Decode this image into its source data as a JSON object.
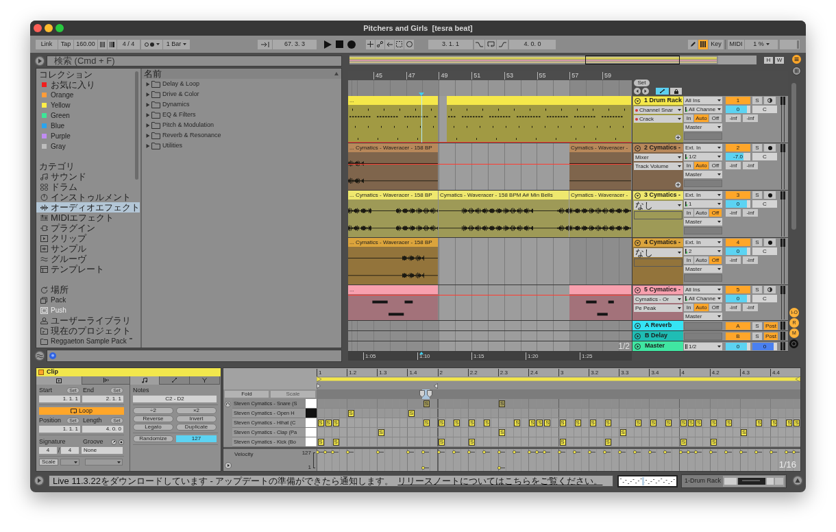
{
  "window": {
    "title": "Pitchers and Girls  [tesra beat]"
  },
  "toolbar": {
    "link": "Link",
    "tap": "Tap",
    "tempo": "160.00",
    "signature": "4 / 4",
    "quantization": "1 Bar",
    "position": "67. 3. 3",
    "loop_start": "3. 1. 1",
    "loop_length": "4. 0. 0",
    "keyboard_on": true,
    "key": "Key",
    "midi": "MIDI",
    "cpu": "1 %"
  },
  "browser": {
    "search": {
      "placeholder": "検索 (Cmd + F)"
    },
    "collections": {
      "heading": "コレクション",
      "items": [
        {
          "label": "お気に入り",
          "color": "#f01e1e"
        },
        {
          "label": "Orange",
          "color": "#ff9c3a"
        },
        {
          "label": "Yellow",
          "color": "#ffee48"
        },
        {
          "label": "Green",
          "color": "#3de698"
        },
        {
          "label": "Blue",
          "color": "#2aa4ee"
        },
        {
          "label": "Purple",
          "color": "#c08cf2"
        },
        {
          "label": "Gray",
          "color": "#bdbdbd"
        }
      ]
    },
    "categories": {
      "heading": "カテゴリ",
      "items": [
        {
          "label": "サウンド",
          "selected": false
        },
        {
          "label": "ドラム",
          "selected": false
        },
        {
          "label": "インストゥルメント",
          "selected": false
        },
        {
          "label": "オーディオエフェクト",
          "selected": true
        },
        {
          "label": "MIDIエフェクト",
          "selected": false
        },
        {
          "label": "プラグイン",
          "selected": false
        },
        {
          "label": "クリップ",
          "selected": false
        },
        {
          "label": "サンプル",
          "selected": false
        },
        {
          "label": "グルーヴ",
          "selected": false
        },
        {
          "label": "テンプレート",
          "selected": false
        }
      ]
    },
    "places": {
      "items": [
        {
          "label": "場所",
          "disabled": false,
          "update": false
        },
        {
          "label": "Pack",
          "disabled": false,
          "update": false
        },
        {
          "label": "Push",
          "disabled": true,
          "update": false
        },
        {
          "label": "ユーザーライブラリ",
          "disabled": false,
          "update": false
        },
        {
          "label": "現在のプロジェクト",
          "disabled": false,
          "update": false
        },
        {
          "label": "Reggaeton Sample Pack",
          "disabled": false,
          "update": true
        }
      ]
    },
    "list": {
      "column": "名前",
      "items": [
        {
          "label": "Delay & Loop",
          "expanded": false
        },
        {
          "label": "Drive & Color",
          "expanded": false
        },
        {
          "label": "Dynamics",
          "expanded": false
        },
        {
          "label": "EQ & Filters",
          "expanded": false
        },
        {
          "label": "Pitch & Modulation",
          "expanded": false
        },
        {
          "label": "Reverb & Resonance",
          "expanded": false
        },
        {
          "label": "Utilities",
          "expanded": false
        }
      ]
    }
  },
  "arrangement": {
    "overview_buttons": [
      "H",
      "W"
    ],
    "ruler": [
      "45",
      "47",
      "49",
      "51",
      "53",
      "55",
      "57",
      "59"
    ],
    "set": "Set",
    "automation_on": true,
    "tracks": [
      {
        "kind": "midi",
        "name": "1 Drum Rack",
        "color": "#f5e84a",
        "selected": true,
        "clips": [
          {
            "kind": "midi",
            "label": "..."
          },
          {
            "kind": "midi"
          }
        ],
        "automation": true,
        "devices": [
          {
            "label": "Channel Snar",
            "dot": true
          },
          {
            "label": "Crack",
            "dot": true
          }
        ],
        "input": "All Ins",
        "channel": "All Channe",
        "monitor": [
          {
            "label": "In",
            "selected": false
          },
          {
            "label": "Auto",
            "selected": true
          },
          {
            "label": "Off",
            "selected": false
          }
        ],
        "output": "Master",
        "number": "1",
        "solo": "S",
        "volume": {
          "value": "0",
          "level": 0.85
        },
        "pan": "C",
        "peaks": [
          "-inf",
          "-inf"
        ]
      },
      {
        "kind": "audio",
        "name": "2 Cymatics -",
        "color": "#b8885a",
        "selected": false,
        "clips": [
          {
            "kind": "audio",
            "label": "... Cymatics - Waveracer - 158 BP"
          },
          {
            "kind": "audio",
            "label": "Cymatics - Waveracer -"
          }
        ],
        "automation": true,
        "devices": [
          {
            "label": "Mixer",
            "dot": false
          },
          {
            "label": "Track Volume",
            "dot": false
          }
        ],
        "input": "Ext. In",
        "channel": "1/2",
        "monitor": [
          {
            "label": "In",
            "selected": false
          },
          {
            "label": "Auto",
            "selected": true
          },
          {
            "label": "Off",
            "selected": false
          }
        ],
        "output": "Master",
        "number": "2",
        "solo": "S",
        "volume": {
          "value": "-7.0",
          "level": 0.72
        },
        "pan": "C",
        "peaks": [
          "-inf",
          "-inf"
        ]
      },
      {
        "kind": "audio",
        "name": "3 Cymatics -",
        "color": "#efe86e",
        "selected": false,
        "clips": [
          {
            "kind": "audio",
            "label": "... Cymatics - Waveracer - 158 BP"
          },
          {
            "kind": "audio",
            "label": "Cymatics - Waveracer - 158 BPM A# Min Bells"
          },
          {
            "kind": "audio",
            "label": "Cymatics - Waveracer -"
          }
        ],
        "devices": [
          {
            "label": "なし",
            "dot": false
          }
        ],
        "input": "Ext. In",
        "channel": "1",
        "monitor": [
          {
            "label": "In",
            "selected": false
          },
          {
            "label": "Auto",
            "selected": false
          },
          {
            "label": "Off",
            "selected": true
          }
        ],
        "output": "Master",
        "number": "3",
        "solo": "S",
        "volume": {
          "value": "0",
          "level": 0.85
        },
        "pan": "C",
        "peaks": [
          "-inf",
          "-inf"
        ]
      },
      {
        "kind": "audio",
        "name": "4 Cymatics -",
        "color": "#dba43c",
        "selected": false,
        "clips": [
          {
            "kind": "audio",
            "label": "... Cymatics - Waveracer - 158 BP"
          }
        ],
        "devices": [
          {
            "label": "なし",
            "dot": false
          }
        ],
        "input": "Ext. In",
        "channel": "2",
        "monitor": [
          {
            "label": "In",
            "selected": false
          },
          {
            "label": "Auto",
            "selected": false
          },
          {
            "label": "Off",
            "selected": true
          }
        ],
        "output": "Master",
        "number": "4",
        "solo": "S",
        "volume": {
          "value": "0",
          "level": 0.85
        },
        "pan": "C",
        "peaks": [
          "-inf",
          "-inf"
        ]
      },
      {
        "kind": "midi",
        "name": "5 Cymatics -",
        "color": "#f8a0ae",
        "selected": false,
        "clips": [
          {
            "kind": "midi",
            "label": "..."
          },
          {
            "kind": "midi"
          }
        ],
        "automation": true,
        "devices": [
          {
            "label": "Cymatics - Or",
            "dot": false
          },
          {
            "label": "Pe Peak",
            "dot": false
          }
        ],
        "input": "All Ins",
        "channel": "All Channe",
        "monitor": [
          {
            "label": "In",
            "selected": false
          },
          {
            "label": "Auto",
            "selected": true
          },
          {
            "label": "Off",
            "selected": false
          }
        ],
        "output": "Master",
        "number": "5",
        "solo": "S",
        "volume": {
          "value": "0",
          "level": 0.85
        },
        "pan": "C",
        "peaks": [
          "-inf",
          "-inf"
        ]
      }
    ],
    "returns": [
      {
        "name": "A Reverb",
        "color": "#35e4f4",
        "letter": "A",
        "solo": "S",
        "post": {
          "label": "Post",
          "on": true
        }
      },
      {
        "name": "B Delay",
        "color": "#1fbdb4",
        "letter": "B",
        "solo": "S",
        "post": {
          "label": "Post",
          "on": true
        }
      }
    ],
    "master": {
      "name": "Master",
      "color": "#40e6a2",
      "output": "1/2",
      "volume": {
        "value": "0",
        "level": 0.85
      },
      "cue": {
        "value": "0",
        "level": 0.85
      }
    },
    "time_ruler": [
      "1:05",
      "1:10",
      "1:15",
      "1:20",
      "1:25"
    ],
    "zoom": "1/2",
    "section_toggles": [
      {
        "label": "I-O",
        "on": true
      },
      {
        "label": "R",
        "on": true
      },
      {
        "label": "M",
        "on": true
      }
    ]
  },
  "clip": {
    "title": "Clip",
    "tabs": [
      {
        "selected": true
      },
      {
        "selected": false
      }
    ],
    "editor_tabs": [
      {
        "selected": true
      },
      {
        "selected": false
      },
      {
        "selected": false
      }
    ],
    "start": {
      "label": "Start",
      "set": "Set",
      "value": "1. 1. 1"
    },
    "end": {
      "label": "End",
      "set": "Set",
      "value": "2. 1. 1"
    },
    "loop": {
      "label": "Loop",
      "on": true
    },
    "position": {
      "label": "Position",
      "set": "Set",
      "value": "1. 1. 1"
    },
    "length": {
      "label": "Length",
      "set": "Set",
      "value": "4. 0. 0"
    },
    "signature": {
      "label": "Signature",
      "numerator": "4",
      "separator": "/",
      "denominator": "4"
    },
    "groove": {
      "label": "Groove",
      "value": "None"
    },
    "scale": "Scale",
    "notes": {
      "label": "Notes",
      "range": "C2 - D2",
      "buttons": [
        "÷2",
        "×2",
        "Reverse",
        "Invert",
        "Legato",
        "Duplicate"
      ],
      "randomize": "Randomize",
      "amount": "127"
    }
  },
  "editor": {
    "ruler": [
      "1",
      "1.2",
      "1.3",
      "1.4",
      "2",
      "2.2",
      "2.3",
      "2.4",
      "3",
      "3.2",
      "3.3",
      "3.4",
      "4",
      "4.2",
      "4.3",
      "4.4"
    ],
    "fold": "Fold",
    "scale": "Scale",
    "lanes": [
      {
        "name": "Steven Cymatics - Snare (S",
        "black_key": false,
        "selected": true,
        "notes": [
          {
            "label": "S",
            "low_velocity": true
          },
          {
            "label": "S",
            "low_velocity": true
          }
        ]
      },
      {
        "name": "Steven Cymatics - Open H",
        "black_key": true,
        "selected": false,
        "notes": [
          {
            "label": "S",
            "low_velocity": false
          },
          {
            "label": "S",
            "low_velocity": false
          }
        ]
      },
      {
        "name": "Steven Cymatics - Hihat (C",
        "black_key": false,
        "selected": false,
        "notes": [
          {
            "label": "S",
            "low_velocity": false
          },
          {
            "label": "S",
            "low_velocity": false
          },
          {
            "label": "S",
            "low_velocity": false
          },
          {
            "label": "S",
            "low_velocity": false
          },
          {
            "label": "S",
            "low_velocity": false
          },
          {
            "label": "S",
            "low_velocity": false
          },
          {
            "label": "S",
            "low_velocity": false
          },
          {
            "label": "S",
            "low_velocity": false
          },
          {
            "label": "S",
            "low_velocity": false
          },
          {
            "label": "S",
            "low_velocity": false
          },
          {
            "label": "S",
            "low_velocity": false
          },
          {
            "label": "S",
            "low_velocity": false
          },
          {
            "label": "S",
            "low_velocity": false
          },
          {
            "label": "S",
            "low_velocity": false
          },
          {
            "label": "S",
            "low_velocity": false
          },
          {
            "label": "S",
            "low_velocity": false
          },
          {
            "label": "S",
            "low_velocity": false
          },
          {
            "label": "S",
            "low_velocity": false
          },
          {
            "label": "S",
            "low_velocity": false
          },
          {
            "label": "S",
            "low_velocity": false
          },
          {
            "label": "S",
            "low_velocity": false
          },
          {
            "label": "S",
            "low_velocity": false
          },
          {
            "label": "S",
            "low_velocity": false
          },
          {
            "label": "S",
            "low_velocity": false
          },
          {
            "label": "S",
            "low_velocity": false
          },
          {
            "label": "S",
            "low_velocity": false
          },
          {
            "label": "S",
            "low_velocity": false
          },
          {
            "label": "S",
            "low_velocity": false
          }
        ]
      },
      {
        "name": "Steven Cymatics - Clap (Pa",
        "black_key": false,
        "selected": false,
        "notes": [
          {
            "label": "S",
            "low_velocity": false
          },
          {
            "label": "S",
            "low_velocity": false
          },
          {
            "label": "S",
            "low_velocity": false
          },
          {
            "label": "S",
            "low_velocity": false
          }
        ]
      },
      {
        "name": "Steven Cymatics - Kick (Bo",
        "black_key": false,
        "selected": false,
        "notes": [
          {
            "label": "S",
            "low_velocity": false
          },
          {
            "label": "S",
            "low_velocity": false
          },
          {
            "label": "S",
            "low_velocity": false
          },
          {
            "label": "S",
            "low_velocity": false
          },
          {
            "label": "S",
            "low_velocity": false
          },
          {
            "label": "S",
            "low_velocity": false
          },
          {
            "label": "S",
            "low_velocity": false
          },
          {
            "label": "S",
            "low_velocity": false
          }
        ]
      }
    ],
    "velocity": {
      "label": "Velocity",
      "max": "127",
      "min": "1"
    },
    "grid": "1/16"
  },
  "status_bar": {
    "message": "Live 11.3.22をダウンロードしています - アップデートの準備ができたら通知します。",
    "link": "リリースノートについてはこちらをご覧ください。",
    "device": "1-Drum Rack"
  }
}
